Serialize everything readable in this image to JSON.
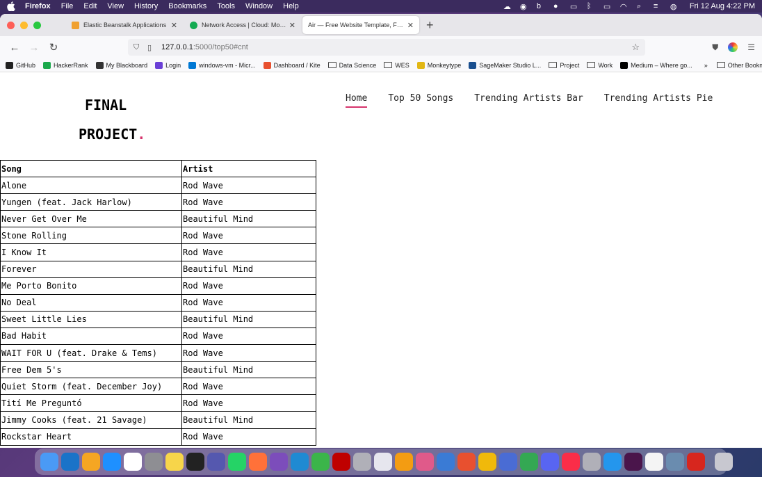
{
  "menubar": {
    "app": "Firefox",
    "items": [
      "File",
      "Edit",
      "View",
      "History",
      "Bookmarks",
      "Tools",
      "Window",
      "Help"
    ],
    "clock": "Fri 12 Aug  4:22 PM"
  },
  "tabs": [
    {
      "label": "Elastic Beanstalk Applications",
      "color": "#f0a030"
    },
    {
      "label": "Network Access | Cloud: MongoDB",
      "color": "#13aa52"
    },
    {
      "label": "Air — Free Website Template, Free HTML",
      "color": "#ffffff",
      "active": true
    }
  ],
  "url": {
    "host": "127.0.0.1",
    "path": ":5000/top50#cnt"
  },
  "bookmarks": [
    {
      "label": "GitHub",
      "type": "site",
      "color": "#222"
    },
    {
      "label": "HackerRank",
      "type": "site",
      "color": "#1ba94c"
    },
    {
      "label": "My Blackboard",
      "type": "site",
      "color": "#333"
    },
    {
      "label": "Login",
      "type": "site",
      "color": "#6a3fd6"
    },
    {
      "label": "windows-vm - Micr...",
      "type": "site",
      "color": "#0078d4"
    },
    {
      "label": "Dashboard / Kite",
      "type": "site",
      "color": "#e8502f"
    },
    {
      "label": "Data Science",
      "type": "folder"
    },
    {
      "label": "WES",
      "type": "folder"
    },
    {
      "label": "Monkeytype",
      "type": "site",
      "color": "#e2b714"
    },
    {
      "label": "SageMaker Studio L...",
      "type": "site",
      "color": "#1a4f8f"
    },
    {
      "label": "Project",
      "type": "folder"
    },
    {
      "label": "Work",
      "type": "folder"
    },
    {
      "label": "Medium – Where go...",
      "type": "site",
      "color": "#000"
    }
  ],
  "bookmarks_more": "»",
  "bookmarks_other": "Other Bookmarks",
  "site": {
    "logo_line1": "FINAL",
    "logo_line2": "PROJECT",
    "logo_dot": ".",
    "nav": [
      {
        "label": "Home",
        "active": true
      },
      {
        "label": "Top 50 Songs"
      },
      {
        "label": "Trending Artists Bar"
      },
      {
        "label": "Trending Artists Pie"
      }
    ]
  },
  "table": {
    "headers": [
      "Song",
      "Artist"
    ],
    "rows": [
      [
        "Alone",
        "Rod Wave"
      ],
      [
        "Yungen (feat. Jack Harlow)",
        "Rod Wave"
      ],
      [
        "Never Get Over Me",
        "Beautiful Mind"
      ],
      [
        "Stone Rolling",
        "Rod Wave"
      ],
      [
        "I Know It",
        "Rod Wave"
      ],
      [
        "Forever",
        "Beautiful Mind"
      ],
      [
        "Me Porto Bonito",
        "Rod Wave"
      ],
      [
        "No Deal",
        "Rod Wave"
      ],
      [
        "Sweet Little Lies",
        "Beautiful Mind"
      ],
      [
        "Bad Habit",
        "Rod Wave"
      ],
      [
        "WAIT FOR U (feat. Drake & Tems)",
        "Rod Wave"
      ],
      [
        "Free Dem 5's",
        "Beautiful Mind"
      ],
      [
        "Quiet Storm (feat. December Joy)",
        "Rod Wave"
      ],
      [
        "Tití Me Preguntó",
        "Rod Wave"
      ],
      [
        "Jimmy Cooks (feat. 21 Savage)",
        "Beautiful Mind"
      ],
      [
        "Rockstar Heart",
        "Rod Wave"
      ]
    ]
  },
  "dock_apps": [
    {
      "name": "finder",
      "color": "#4a9af5"
    },
    {
      "name": "outlook",
      "color": "#1a73c8"
    },
    {
      "name": "photos",
      "color": "#f5a623"
    },
    {
      "name": "app-store",
      "color": "#1e90ff"
    },
    {
      "name": "calendar",
      "color": "#ffffff"
    },
    {
      "name": "system-preferences",
      "color": "#8e8e93"
    },
    {
      "name": "notes",
      "color": "#f7d54a"
    },
    {
      "name": "terminal",
      "color": "#222222"
    },
    {
      "name": "teams",
      "color": "#5558af"
    },
    {
      "name": "whatsapp",
      "color": "#25d366"
    },
    {
      "name": "firefox",
      "color": "#ff7139"
    },
    {
      "name": "visual-studio",
      "color": "#7c4dbb"
    },
    {
      "name": "vscode",
      "color": "#1f8ad2"
    },
    {
      "name": "spinner",
      "color": "#3bb54a"
    },
    {
      "name": "filezilla",
      "color": "#bf0000"
    },
    {
      "name": "unknown-app",
      "color": "#b0b0b8"
    },
    {
      "name": "textedit",
      "color": "#e6e6ee"
    },
    {
      "name": "pages",
      "color": "#f39c12"
    },
    {
      "name": "launchpad",
      "color": "#e05a8a"
    },
    {
      "name": "xcode",
      "color": "#3a7bd5"
    },
    {
      "name": "git-app",
      "color": "#e8502f"
    },
    {
      "name": "binance",
      "color": "#f0b90b"
    },
    {
      "name": "remote-desktop",
      "color": "#4a6cd4"
    },
    {
      "name": "chrome",
      "color": "#34a853"
    },
    {
      "name": "discord",
      "color": "#5865f2"
    },
    {
      "name": "music",
      "color": "#fa2d48"
    },
    {
      "name": "unknown-app-2",
      "color": "#b0b0b8"
    },
    {
      "name": "docker",
      "color": "#2496ed"
    },
    {
      "name": "slack",
      "color": "#4a154b"
    },
    {
      "name": "reminders",
      "color": "#f4f4f4"
    },
    {
      "name": "preview",
      "color": "#6a8caf"
    },
    {
      "name": "acrobat",
      "color": "#d7261e"
    },
    {
      "name": "trash",
      "color": "#c8c8d0"
    }
  ]
}
